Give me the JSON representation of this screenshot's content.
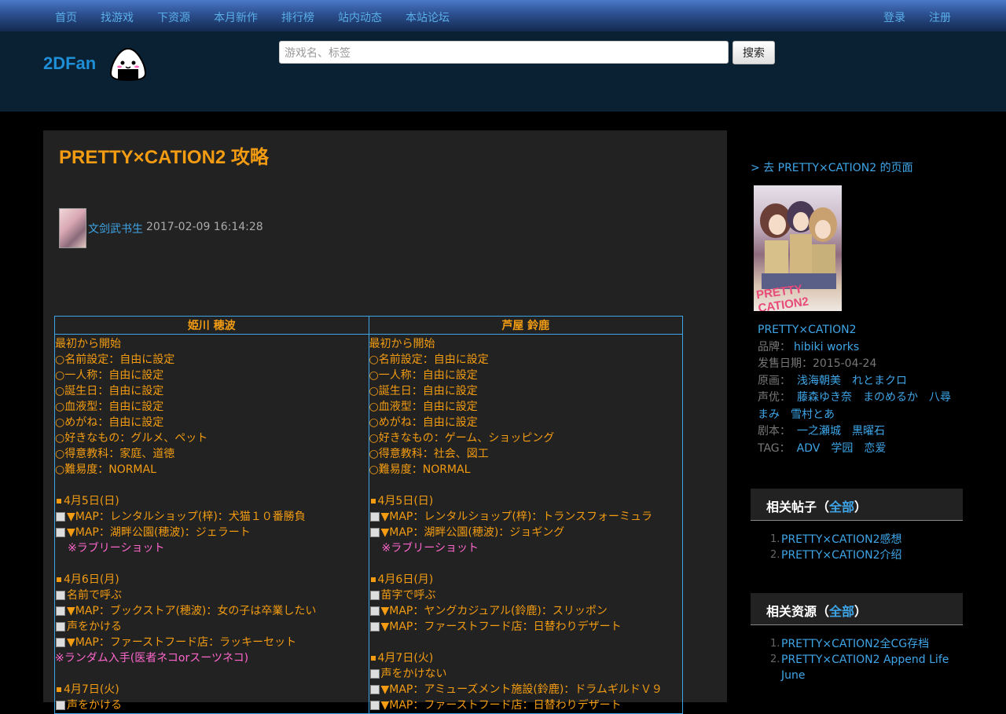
{
  "nav": {
    "left": [
      "首页",
      "找游戏",
      "下资源",
      "本月新作",
      "排行榜",
      "站内动态",
      "本站论坛"
    ],
    "login": "登录",
    "register": "注册"
  },
  "header": {
    "logo": "2DFan",
    "search_placeholder": "游戏名、标签",
    "search_button": "搜索"
  },
  "post": {
    "title": "PRETTY×CATION2 攻略",
    "author": "文剑武书生",
    "date": "2017-02-09 16:14:28"
  },
  "guide": {
    "headers": [
      "姫川 穂波",
      "芦屋 鈴鹿"
    ],
    "left": [
      {
        "t": "最初から開始"
      },
      {
        "t": "○名前設定：自由に設定"
      },
      {
        "t": "○一人称：自由に設定"
      },
      {
        "t": "○誕生日：自由に設定"
      },
      {
        "t": "○血液型：自由に設定"
      },
      {
        "t": "○めがね：自由に設定"
      },
      {
        "t": "○好きなもの：グルメ、ペット"
      },
      {
        "t": "○得意教科：家庭、道徳"
      },
      {
        "t": "○難易度：NORMAL"
      },
      {
        "t": ""
      },
      {
        "t": "4月5日(日)",
        "k": "sq"
      },
      {
        "t": "▼MAP：レンタルショップ(梓)：犬猫１０番勝負",
        "k": "cb"
      },
      {
        "t": "▼MAP：湖畔公園(穂波)：ジェラート",
        "k": "cb"
      },
      {
        "t": "※ラブリーショット",
        "k": "pk-ind"
      },
      {
        "t": ""
      },
      {
        "t": "4月6日(月)",
        "k": "sq"
      },
      {
        "t": "名前で呼ぶ",
        "k": "cb"
      },
      {
        "t": "▼MAP：ブックストア(穂波)：女の子は卒業したい",
        "k": "cb"
      },
      {
        "t": "声をかける",
        "k": "cb"
      },
      {
        "t": "▼MAP：ファーストフード店：ラッキーセット",
        "k": "cb"
      },
      {
        "t": "※ランダム入手(医者ネコorスーツネコ)",
        "k": "pk"
      },
      {
        "t": ""
      },
      {
        "t": "4月7日(火)",
        "k": "sq"
      },
      {
        "t": "声をかける",
        "k": "cb"
      }
    ],
    "right": [
      {
        "t": "最初から開始"
      },
      {
        "t": "○名前設定：自由に設定"
      },
      {
        "t": "○一人称：自由に設定"
      },
      {
        "t": "○誕生日：自由に設定"
      },
      {
        "t": "○血液型：自由に設定"
      },
      {
        "t": "○めがね：自由に設定"
      },
      {
        "t": "○好きなもの：ゲーム、ショッピング"
      },
      {
        "t": "○得意教科：社会、図工"
      },
      {
        "t": "○難易度：NORMAL"
      },
      {
        "t": ""
      },
      {
        "t": "4月5日(日)",
        "k": "sq"
      },
      {
        "t": "▼MAP：レンタルショップ(梓)：トランスフォーミュラ",
        "k": "cb"
      },
      {
        "t": "▼MAP：湖畔公園(穂波)：ジョギング",
        "k": "cb"
      },
      {
        "t": "※ラブリーショット",
        "k": "pk-ind"
      },
      {
        "t": ""
      },
      {
        "t": "4月6日(月)",
        "k": "sq"
      },
      {
        "t": "苗字で呼ぶ",
        "k": "cb"
      },
      {
        "t": "▼MAP：ヤングカジュアル(鈴鹿)：スリッポン",
        "k": "cb"
      },
      {
        "t": "▼MAP：ファーストフード店：日替わりデザート",
        "k": "cb"
      },
      {
        "t": ""
      },
      {
        "t": "4月7日(火)",
        "k": "sq"
      },
      {
        "t": "声をかけない",
        "k": "cb"
      },
      {
        "t": "▼MAP：アミューズメント施設(鈴鹿)：ドラムギルドＶ９",
        "k": "cb"
      },
      {
        "t": "▼MAP：ファーストフード店：日替わりデザート",
        "k": "cb"
      }
    ]
  },
  "sidebar": {
    "goto": "> 去 PRETTY×CATION2 的页面",
    "cover_logo": "PRETTY CATION2",
    "game_title": "PRETTY×CATION2",
    "brand_label": "品牌：",
    "brand": "hibiki works",
    "release": "发售日期：2015-04-24",
    "art_label": "原画：",
    "art": [
      "浅海朝美",
      "れとまクロ"
    ],
    "cv_label": "声优：",
    "cv_line1": [
      "藤森ゆき奈",
      "まのめるか",
      "八尋"
    ],
    "cv_line2": [
      "まみ",
      "雪村とあ"
    ],
    "script_label": "剧本：",
    "script": [
      "一之瀬城",
      "黒曜石"
    ],
    "tag_label": "TAG：",
    "tags": [
      "ADV",
      "学园",
      "恋爱"
    ],
    "related_posts": {
      "title": "相关帖子",
      "all": "全部",
      "items": [
        "PRETTY×CATION2感想",
        "PRETTY×CATION2介绍"
      ]
    },
    "related_resources": {
      "title": "相关资源",
      "all": "全部",
      "items": [
        "PRETTY×CATION2全CG存档",
        "PRETTY×CATION2 Append Life June"
      ]
    }
  }
}
